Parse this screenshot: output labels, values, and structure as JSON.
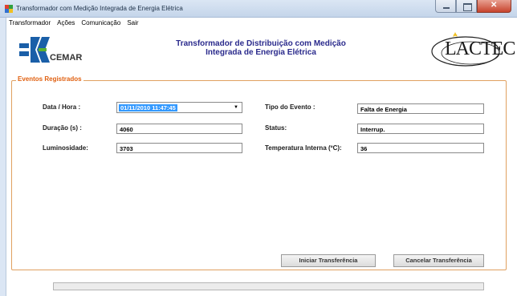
{
  "window": {
    "title": "Transformador com Medição Integrada de Energia Elétrica"
  },
  "menu": {
    "items": [
      "Transformador",
      "Ações",
      "Comunicação",
      "Sair"
    ]
  },
  "header": {
    "cemar_logo_text": "CEMAR",
    "title_line1": "Transformador de Distribuição  com Medição",
    "title_line2": "Integrada de Energia Elétrica",
    "lactec_logo_text": "LACTEC"
  },
  "group": {
    "legend": "Eventos Registrados"
  },
  "fields": {
    "data_hora": {
      "label": "Data / Hora :",
      "value": "01/11/2010 11:47:45"
    },
    "duracao": {
      "label": "Duração (s) :",
      "value": "4060"
    },
    "luminosidade": {
      "label": "Luminosidade:",
      "value": "3703"
    },
    "tipo_evento": {
      "label": "Tipo do Evento :",
      "value": "Falta de Energia"
    },
    "status": {
      "label": "Status:",
      "value": "Interrup."
    },
    "temperatura": {
      "label": "Temperatura Interna (ºC):",
      "value": "36"
    }
  },
  "buttons": {
    "iniciar": "Iniciar Transferência",
    "cancelar": "Cancelar Transferência"
  },
  "progress": {
    "value": 0
  },
  "colors": {
    "accent": "#e06010",
    "title": "#2a2a8c",
    "selection": "#3399ff"
  }
}
